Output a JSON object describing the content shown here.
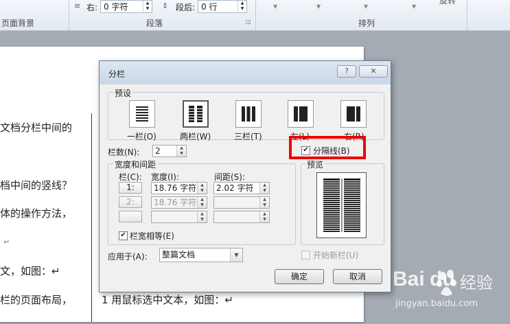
{
  "ribbon": {
    "right_indent_label": "右:",
    "right_indent_value": "0 字符",
    "after_spacing_label": "段后:",
    "after_spacing_value": "0 行",
    "group_page_background": "页面背景",
    "group_paragraph": "段落",
    "group_arrange": "排列",
    "top_right_partial": "旋转"
  },
  "document": {
    "lines": [
      {
        "text": "文档分栏中间的"
      },
      {
        "text": "档中间的竖线？"
      },
      {
        "text": "体的操作方法，"
      },
      {
        "text": "↵"
      },
      {
        "text": "文，如图：↵"
      },
      {
        "text": "栏的页面布局，"
      },
      {
        "text": "1 用鼠标选中文本，如图：↵"
      }
    ]
  },
  "dialog": {
    "title": "分栏",
    "help_button": "?",
    "close_button": "✕",
    "presets_group": "预设",
    "presets": [
      {
        "label": "一栏(O)"
      },
      {
        "label": "两栏(W)"
      },
      {
        "label": "三栏(T)"
      },
      {
        "label": "左(L)"
      },
      {
        "label": "右(R)"
      }
    ],
    "num_columns_label": "栏数(N):",
    "num_columns_value": "2",
    "line_between_label": "分隔线(B)",
    "line_between_checked": true,
    "width_spacing_group": "宽度和间距",
    "col_header": "栏(C):",
    "width_header": "宽度(I):",
    "spacing_header": "间距(S):",
    "rows": [
      {
        "num": "1:",
        "width": "18.76 字符",
        "spacing": "2.02 字符"
      },
      {
        "num": "2:",
        "width": "18.76 字符",
        "spacing": ""
      },
      {
        "num": "",
        "width": "",
        "spacing": ""
      }
    ],
    "equal_width_label": "栏宽相等(E)",
    "equal_width_checked": true,
    "preview_group": "预览",
    "apply_to_label": "应用于(A):",
    "apply_to_value": "整篇文档",
    "start_new_column_label": "开始新栏(U)",
    "ok_button": "确定",
    "cancel_button": "取消"
  },
  "watermark": {
    "brand": "Bai",
    "brand_suffix": "经验",
    "url": "jingyan.baidu.com"
  }
}
